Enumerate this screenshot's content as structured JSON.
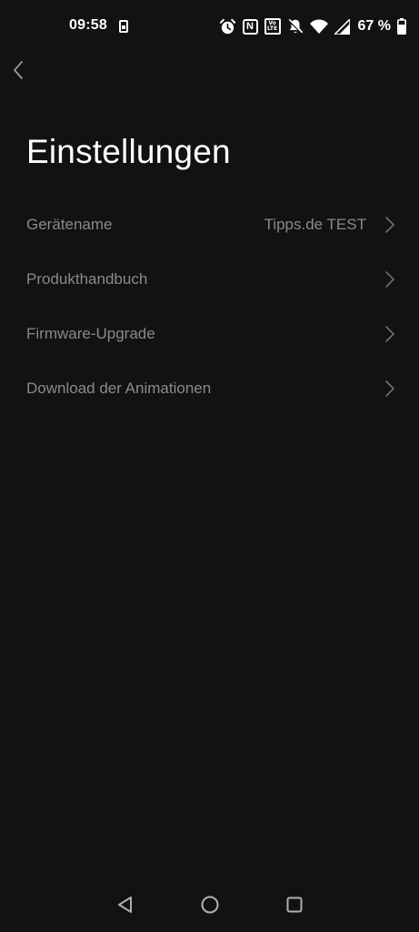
{
  "status_bar": {
    "time": "09:58",
    "battery": "67 %",
    "icons": [
      "sim-icon",
      "alarm-icon",
      "nfc-icon",
      "volte-icon",
      "bell-off-icon",
      "wifi-icon",
      "signal-icon",
      "battery-icon"
    ],
    "volte_top": "Vo",
    "volte_bottom": "LTE",
    "nfc_letter": "N"
  },
  "header": {
    "back_icon": "chevron-left-icon",
    "title": "Einstellungen"
  },
  "settings": {
    "items": [
      {
        "label": "Gerätename",
        "value": "Tipps.de TEST"
      },
      {
        "label": "Produkthandbuch",
        "value": ""
      },
      {
        "label": "Firmware-Upgrade",
        "value": ""
      },
      {
        "label": "Download der Animationen",
        "value": ""
      }
    ]
  },
  "nav_bar": {
    "icons": [
      "nav-back-icon",
      "nav-home-icon",
      "nav-recents-icon"
    ]
  },
  "colors": {
    "background": "#121212",
    "text_primary": "#ffffff",
    "text_secondary": "#8a8a8a",
    "chevron": "#6e6e6e"
  }
}
